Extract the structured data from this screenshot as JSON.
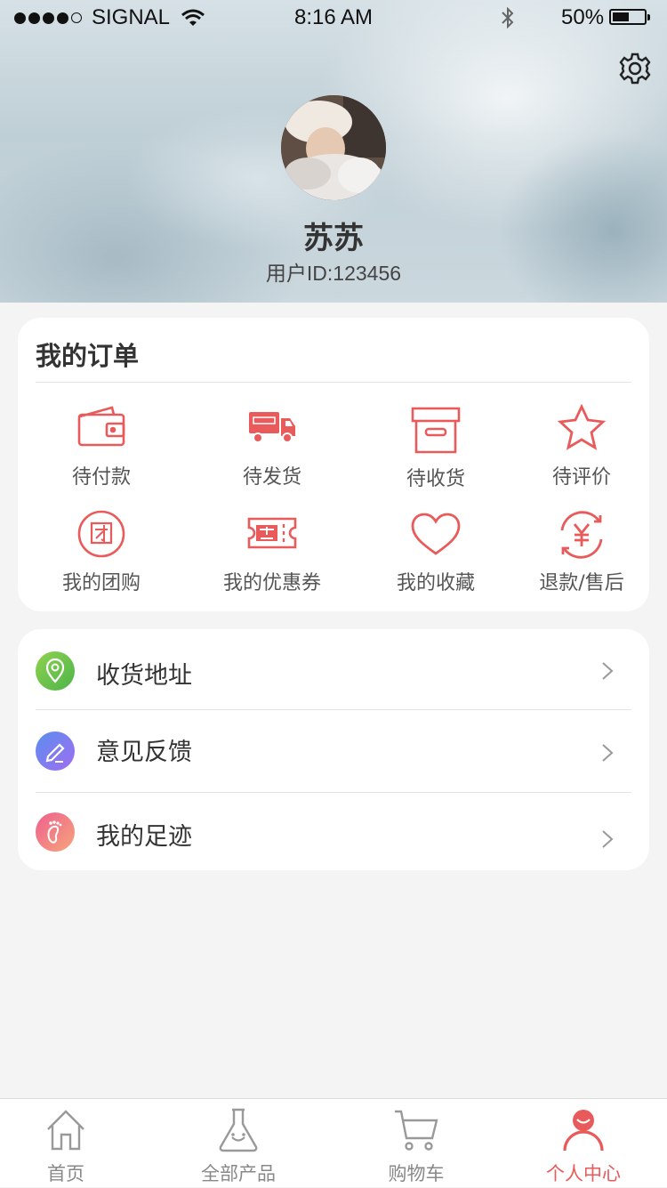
{
  "status_bar": {
    "carrier": "SIGNAL",
    "time": "8:16 AM",
    "battery": "50%",
    "battery_level": 0.5
  },
  "profile": {
    "name": "苏苏",
    "user_id": "用户ID:123456"
  },
  "orders": {
    "title": "我的订单",
    "items": [
      {
        "label": "待付款",
        "icon": "wallet-icon"
      },
      {
        "label": "待发货",
        "icon": "truck-icon"
      },
      {
        "label": "待收货",
        "icon": "box-icon"
      },
      {
        "label": "待评价",
        "icon": "star-icon"
      },
      {
        "label": "我的团购",
        "icon": "group-buy-icon"
      },
      {
        "label": "我的优惠券",
        "icon": "coupon-icon"
      },
      {
        "label": "我的收藏",
        "icon": "heart-icon"
      },
      {
        "label": "退款/售后",
        "icon": "refund-icon"
      }
    ]
  },
  "menu": [
    {
      "label": "收货地址",
      "icon": "location-icon",
      "color": "#6cc04a"
    },
    {
      "label": "意见反馈",
      "icon": "pencil-icon",
      "color": "#6f7df0"
    },
    {
      "label": "我的足迹",
      "icon": "footprint-icon",
      "color": "#f07a8a"
    }
  ],
  "tabbar": [
    {
      "label": "首页",
      "icon": "home-icon",
      "active": false
    },
    {
      "label": "全部产品",
      "icon": "flask-icon",
      "active": false
    },
    {
      "label": "购物车",
      "icon": "cart-icon",
      "active": false
    },
    {
      "label": "个人中心",
      "icon": "person-icon",
      "active": true
    }
  ],
  "colors": {
    "accent": "#e95a5b",
    "background": "#f4f4f4"
  }
}
